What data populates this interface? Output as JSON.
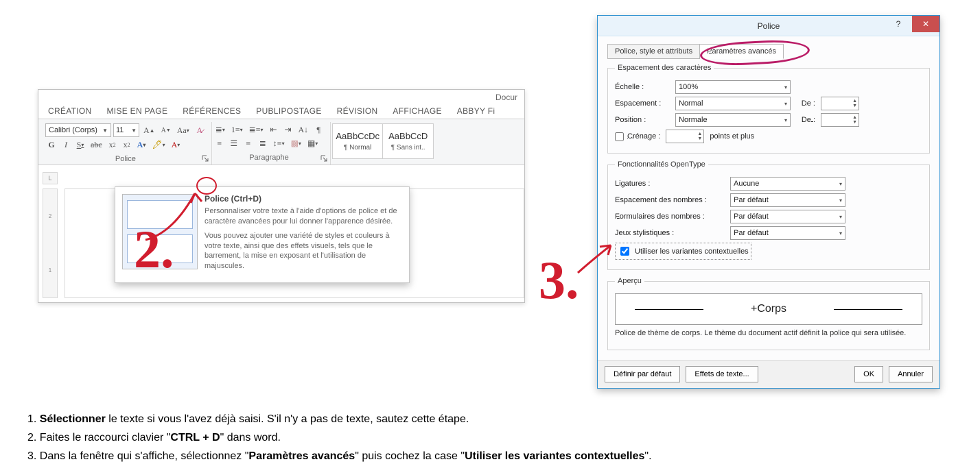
{
  "word": {
    "title": "Docur",
    "tabs": [
      "CRÉATION",
      "MISE EN PAGE",
      "RÉFÉRENCES",
      "PUBLIPOSTAGE",
      "RÉVISION",
      "AFFICHAGE",
      "ABBYY Fi"
    ],
    "font_name": "Calibri (Corps)",
    "font_size": "11",
    "group_font_label": "Police",
    "group_para_label": "Paragraphe",
    "styles": [
      {
        "preview": "AaBbCcDc",
        "name": "¶ Normal"
      },
      {
        "preview": "AaBbCcD",
        "name": "¶ Sans int.."
      }
    ],
    "tooltip": {
      "title": "Police (Ctrl+D)",
      "p1": "Personnaliser votre texte à l'aide d'options de police et de caractère avancées pour lui donner l'apparence désirée.",
      "p2": "Vous pouvez ajouter une variété de styles et couleurs à votre texte, ainsi que des effets visuels, tels que le barrement, la mise en exposant et l'utilisation de majuscules."
    },
    "ruler_marks": [
      "",
      "",
      "2",
      "",
      "1"
    ],
    "ruler_corner": "L"
  },
  "dialog": {
    "title": "Police",
    "tabs": {
      "basic": "Police, style et attributs",
      "advanced": "Paramètres avancés"
    },
    "section_spacing": "Espacement des caractères",
    "fields": {
      "scale_label": "Échelle :",
      "scale_value": "100%",
      "spacing_label": "Espacement :",
      "spacing_value": "Normal",
      "position_label": "Position :",
      "position_value": "Normale",
      "de_label": "De :",
      "kerning_label": "Crénage :",
      "kerning_suffix": "points et plus"
    },
    "section_ot": "Fonctionnalités OpenType",
    "ot": {
      "ligatures_label": "Ligatures :",
      "ligatures_value": "Aucune",
      "numspacing_label": "Espacement des nombres :",
      "numspacing_value": "Par défaut",
      "numforms_label": "Formulaires des nombres :",
      "numforms_value": "Par défaut",
      "styleset_label": "Jeux stylistiques :",
      "styleset_value": "Par défaut",
      "contextual_label": "Utiliser les variantes contextuelles"
    },
    "preview_legend": "Aperçu",
    "preview_text": "+Corps",
    "note": "Police de thème de corps. Le thème du document actif définit la police qui sera utilisée.",
    "buttons": {
      "default": "Définir par défaut",
      "effects": "Effets de texte...",
      "ok": "OK",
      "cancel": "Annuler"
    }
  },
  "annotations": {
    "n2": "2.",
    "n3": "3."
  },
  "instructions": {
    "l1a": "1. ",
    "l1b": "Sélectionner",
    "l1c": " le texte si vous l'avez déjà saisi. S'il n'y a pas de texte, sautez cette étape.",
    "l2a": "2. Faites le raccourci clavier \"",
    "l2b": "CTRL + D",
    "l2c": "\" dans word.",
    "l3a": "3. Dans la fenêtre qui s'affiche, sélectionnez \"",
    "l3b": "Paramètres avancés",
    "l3c": "\" puis cochez la case \"",
    "l3d": "Utiliser les variantes contextuelles",
    "l3e": "\"."
  }
}
